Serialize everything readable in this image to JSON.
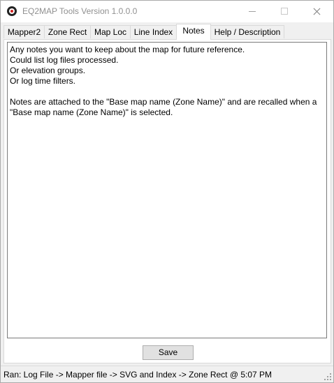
{
  "window": {
    "title": "EQ2MAP Tools Version 1.0.0.0"
  },
  "tabs": [
    {
      "label": "Mapper2"
    },
    {
      "label": "Zone Rect"
    },
    {
      "label": "Map Loc"
    },
    {
      "label": "Line Index"
    },
    {
      "label": "Notes"
    },
    {
      "label": "Help / Description"
    }
  ],
  "active_tab": "Notes",
  "notes": {
    "text": "Any notes you want to keep about the map for future reference.\nCould list log files processed.\nOr elevation groups.\nOr log time filters.\n\nNotes are attached to the \"Base map name (Zone Name)\" and are recalled when a \"Base map name (Zone Name)\" is selected.",
    "save_label": "Save"
  },
  "status": {
    "text": "Ran: Log File -> Mapper file -> SVG and Index -> Zone Rect @ 5:07 PM"
  },
  "icons": {
    "app": "eq2map-app-icon",
    "minimize": "minimize-icon",
    "maximize": "maximize-icon",
    "close": "close-icon",
    "grip": "size-grip-icon"
  }
}
